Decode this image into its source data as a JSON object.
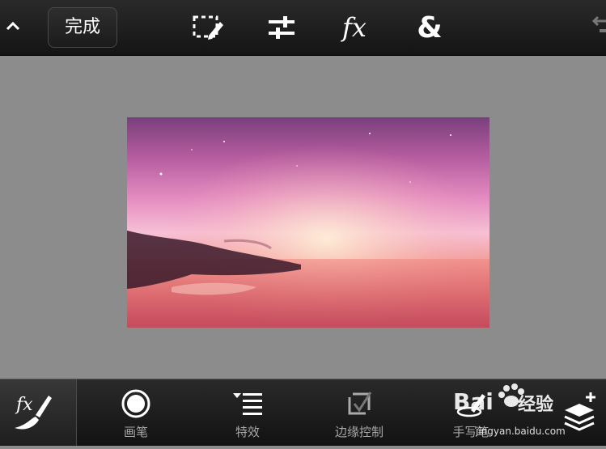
{
  "toolbar": {
    "done_label": "完成",
    "collapse_icon": "chevron-up-icon",
    "tools": [
      {
        "name": "selection-tool",
        "icon": "dashed-select-pencil-icon"
      },
      {
        "name": "adjust-tool",
        "icon": "sliders-icon"
      },
      {
        "name": "fx-tool",
        "label": "fx"
      },
      {
        "name": "blend-tool",
        "label": "&"
      }
    ]
  },
  "bottom_tools": [
    {
      "label": "画笔",
      "icon": "brush-circle-icon"
    },
    {
      "label": "特效",
      "icon": "effects-list-icon"
    },
    {
      "label": "边缘控制",
      "icon": "edge-control-icon"
    },
    {
      "label": "手写笔",
      "icon": "stylus-icon"
    }
  ],
  "watermark": {
    "brand": "Bai",
    "suffix": "经验",
    "url": "jingyan.baidu.com"
  },
  "colors": {
    "background": "#8c8c8c",
    "bar": "#1b1b1b",
    "label": "#a8a8a8"
  }
}
